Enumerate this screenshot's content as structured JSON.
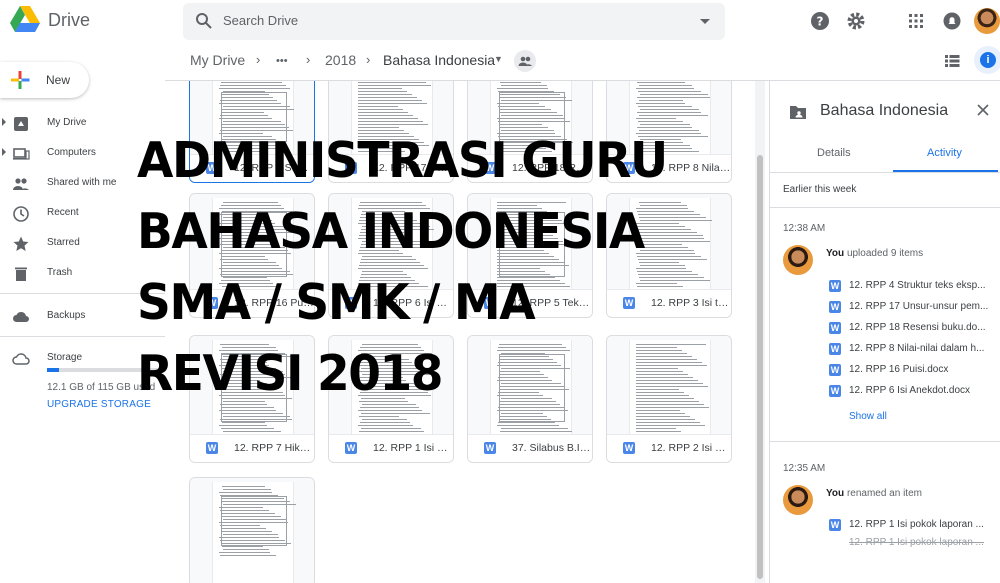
{
  "app": {
    "name": "Drive"
  },
  "search": {
    "placeholder": "Search Drive"
  },
  "sidebar": {
    "new_label": "New",
    "items": [
      {
        "label": "My Drive",
        "icon": "my-drive-icon"
      },
      {
        "label": "Computers",
        "icon": "computer-icon"
      },
      {
        "label": "Shared with me",
        "icon": "people-icon"
      },
      {
        "label": "Recent",
        "icon": "clock-icon"
      },
      {
        "label": "Starred",
        "icon": "star-icon"
      },
      {
        "label": "Trash",
        "icon": "trash-icon"
      },
      {
        "label": "Backups",
        "icon": "cloud-icon"
      },
      {
        "label": "Storage",
        "icon": "cloud-outline-icon"
      }
    ],
    "storage_used_fraction": 0.105,
    "storage_text": "12.1 GB of 115 GB used",
    "upgrade_label": "UPGRADE STORAGE"
  },
  "breadcrumb": {
    "root": "My Drive",
    "ellipsis": "•••",
    "items": [
      "2018",
      "Bahasa Indonesia"
    ]
  },
  "files": [
    {
      "name": "12. RPP 4 Struktur teks eksp...",
      "selected": true
    },
    {
      "name": "12. RPP 17 Unsur-unsur pem..."
    },
    {
      "name": "12. RPP 18 Resensi buku.do..."
    },
    {
      "name": "12. RPP 8 Nilai-nilai dalam h..."
    },
    {
      "name": "12. RPP 16 Puisi.docx"
    },
    {
      "name": "12. RPP 6 Isi Anekdot.docx"
    },
    {
      "name": "12. RPP 5 Teks..."
    },
    {
      "name": "12. RPP 3 Isi teks..."
    },
    {
      "name": "12. RPP 7 Hikayat.docx"
    },
    {
      "name": "12. RPP 1 Isi pokok laporan..."
    },
    {
      "name": "37. Silabus B.Indonesia.docx"
    },
    {
      "name": "12. RPP 2 Isi pokok..."
    },
    {
      "name": ""
    }
  ],
  "details_panel": {
    "title": "Bahasa Indonesia",
    "tabs": [
      "Details",
      "Activity"
    ],
    "active_tab": "Activity",
    "section": "Earlier this week",
    "events": [
      {
        "time": "12:38 AM",
        "actor": "You",
        "action": "uploaded 9 items",
        "files": [
          "12. RPP 4 Struktur teks eksp...",
          "12. RPP 17 Unsur-unsur pem...",
          "12. RPP 18 Resensi buku.do...",
          "12. RPP 8 Nilai-nilai dalam h...",
          "12. RPP 16 Puisi.docx",
          "12. RPP 6 Isi Anekdot.docx"
        ],
        "show_all": "Show all"
      },
      {
        "time": "12:35 AM",
        "actor": "You",
        "action": "renamed an item",
        "new_name": "12. RPP 1 Isi pokok laporan ...",
        "old_name": "12. RPP 1 Isi pokok laporan ..."
      }
    ]
  },
  "overlay": {
    "lines": [
      "ADMINISTRASI GURU",
      "BAHASA INDONESIA",
      "SMA / SMK / MA",
      "REVISI 2018"
    ]
  },
  "colors": {
    "accent": "#1a73e8",
    "word_icon": "#4a86e8",
    "overlay_text": "#000000"
  }
}
